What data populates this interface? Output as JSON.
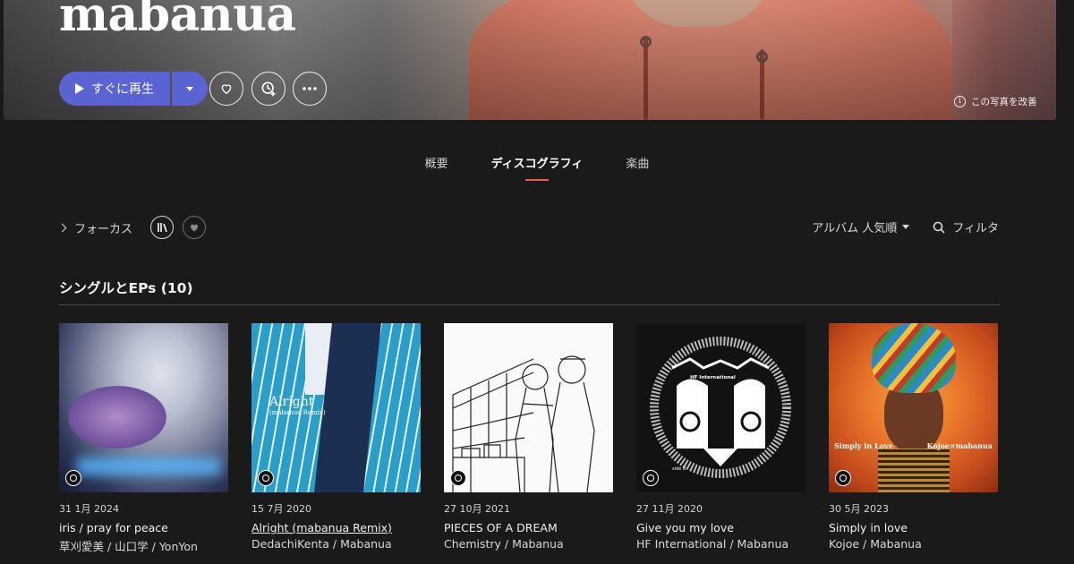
{
  "hero": {
    "artist_name": "mabanua",
    "play_label": "すぐに再生",
    "improve_photo_label": "この写真を改善",
    "info_icon_glyph": "i"
  },
  "tabs": [
    {
      "label": "概要",
      "active": false
    },
    {
      "label": "ディスコグラフィ",
      "active": true
    },
    {
      "label": "楽曲",
      "active": false
    }
  ],
  "toolbar": {
    "focus_label": "フォーカス",
    "sort_label": "アルバム 人気順",
    "filter_label": "フィルタ"
  },
  "section": {
    "title": "シングルとEPs (10)"
  },
  "albums": [
    {
      "date": "31 1月 2024",
      "title": "iris / pray for peace",
      "artist": "草刈愛美 / 山口学 / YonYon"
    },
    {
      "date": "15 7月 2020",
      "title": "Alright (mabanua Remix)",
      "artist": "DedachiKenta / Mabanua",
      "cover_text": "Alright",
      "cover_subtext": "(mabanua Remix)"
    },
    {
      "date": "27 10月 2021",
      "title": "PIECES OF A DREAM",
      "artist": "Chemistry / Mabanua"
    },
    {
      "date": "27 11月 2020",
      "title": "Give you my love",
      "artist": "HF International / Mabanua",
      "cover_text": "HF International",
      "cover_subtext": "side B"
    },
    {
      "date": "30 5月 2023",
      "title": "Simply in love",
      "artist": "Kojoe / Mabanua",
      "cover_text": "Simply in Love",
      "cover_subtext": "Kojoe×mabanua"
    }
  ],
  "colors": {
    "accent": "#5b63d3",
    "tab_indicator": "#e06050",
    "background": "#1a1a1a"
  }
}
